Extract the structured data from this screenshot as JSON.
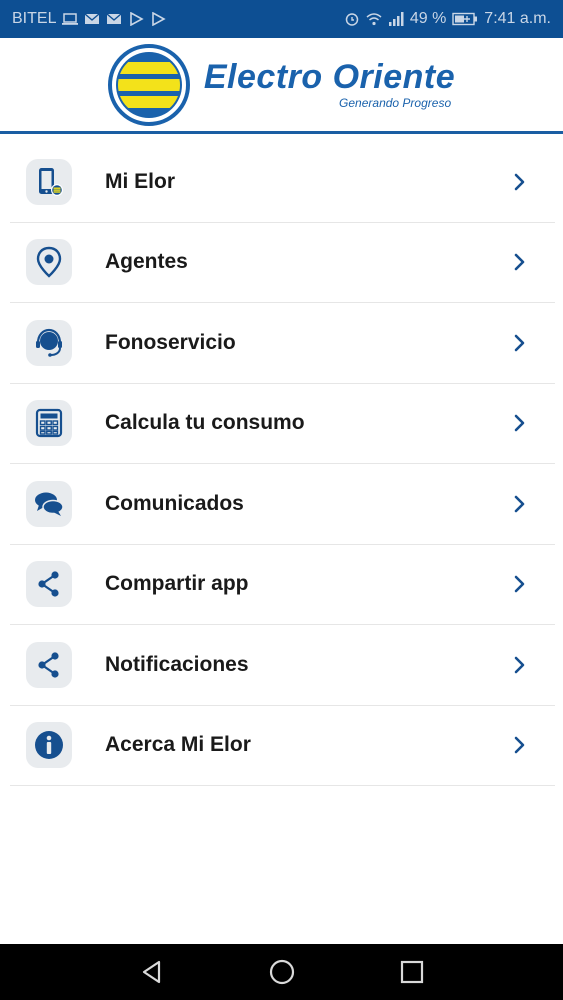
{
  "status_bar": {
    "carrier": "BITEL",
    "battery": "49 %",
    "time": "7:41 a.m."
  },
  "header": {
    "brand": "Electro Oriente",
    "tagline": "Generando Progreso"
  },
  "menu": {
    "items": [
      {
        "label": "Mi Elor",
        "icon": "phone-icon"
      },
      {
        "label": "Agentes",
        "icon": "location-pin-icon"
      },
      {
        "label": "Fonoservicio",
        "icon": "headset-icon"
      },
      {
        "label": "Calcula tu consumo",
        "icon": "calculator-icon"
      },
      {
        "label": "Comunicados",
        "icon": "chat-bubbles-icon"
      },
      {
        "label": "Compartir app",
        "icon": "share-icon"
      },
      {
        "label": "Notificaciones",
        "icon": "share-icon"
      },
      {
        "label": "Acerca Mi Elor",
        "icon": "info-icon"
      }
    ]
  },
  "colors": {
    "status_bar": "#0d4f93",
    "brand_blue": "#1a62ac",
    "icon_blue": "#164f8f",
    "logo_yellow": "#f3e21a"
  }
}
